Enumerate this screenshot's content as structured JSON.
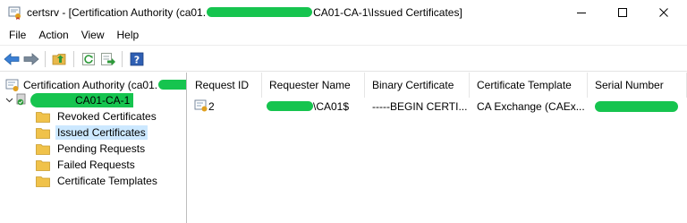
{
  "window": {
    "title_prefix": "certsrv - [Certification Authority (ca01.",
    "title_suffix": "CA01-CA-1\\Issued Certificates]",
    "controls": {
      "minimize": "minimize-icon",
      "maximize": "maximize-icon",
      "close": "close-icon"
    }
  },
  "menu": {
    "items": [
      "File",
      "Action",
      "View",
      "Help"
    ]
  },
  "toolbar": {
    "icons": [
      "back-arrow-icon",
      "forward-arrow-icon",
      "up-folder-icon",
      "refresh-icon",
      "export-list-icon",
      "help-icon"
    ]
  },
  "tree": {
    "root_label": "Certification Authority (ca01.",
    "ca_label": "CA01-CA-1",
    "folders": [
      {
        "label": "Revoked Certificates",
        "selected": false
      },
      {
        "label": "Issued Certificates",
        "selected": true
      },
      {
        "label": "Pending Requests",
        "selected": false
      },
      {
        "label": "Failed Requests",
        "selected": false
      },
      {
        "label": "Certificate Templates",
        "selected": false
      }
    ]
  },
  "list": {
    "columns": [
      "Request ID",
      "Requester Name",
      "Binary Certificate",
      "Certificate Template",
      "Serial Number"
    ],
    "rows": [
      {
        "request_id": "2",
        "requester_suffix": "\\CA01$",
        "binary_certificate": "-----BEGIN CERTI...",
        "certificate_template": "CA Exchange (CAEx..."
      }
    ]
  },
  "colors": {
    "redaction": "#16c44f",
    "selection": "#cce8ff",
    "folder": "#f0c24a"
  }
}
